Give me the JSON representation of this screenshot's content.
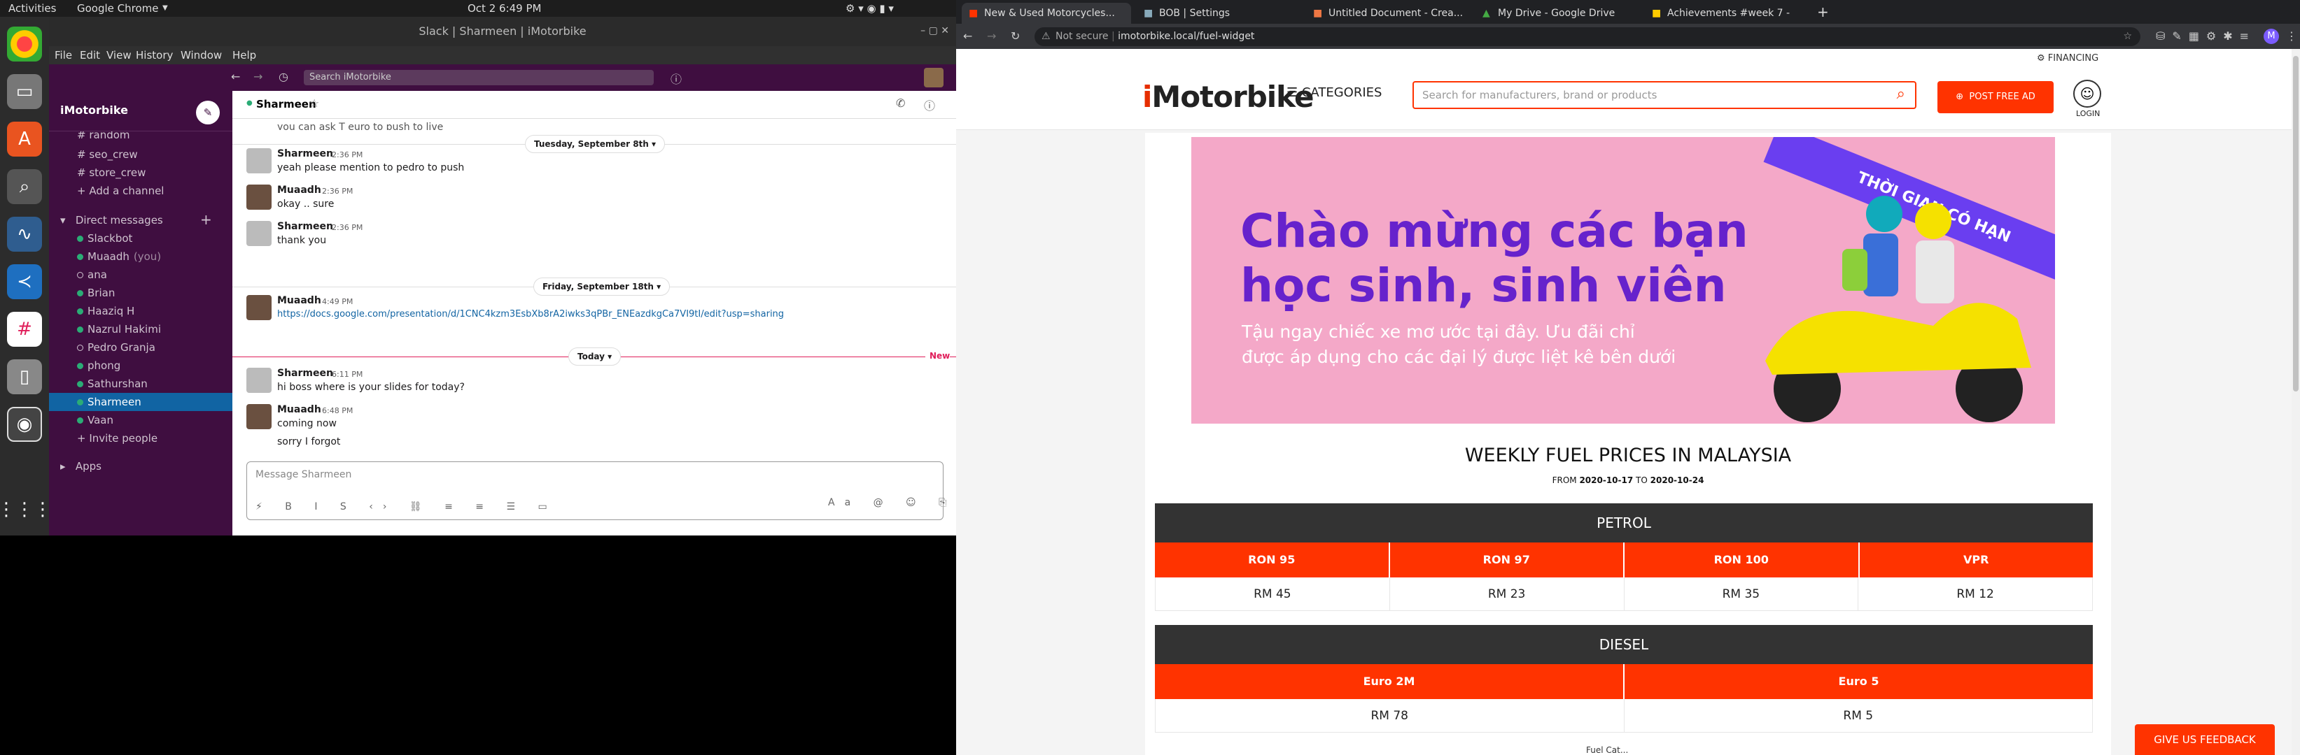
{
  "topbar": {
    "activities": "Activities",
    "app": "Google Chrome",
    "datetime": "Oct 2  6:49 PM"
  },
  "slack": {
    "window_title": "Slack | Sharmeen | iMotorbike",
    "menu": [
      "File",
      "Edit",
      "View",
      "History",
      "Window",
      "Help"
    ],
    "search_placeholder": "Search iMotorbike",
    "workspace": "iMotorbike",
    "channels": [
      "random",
      "seo_crew",
      "store_crew"
    ],
    "add_channel": "Add a channel",
    "dm_header": "Direct messages",
    "dms": [
      {
        "name": "Slackbot",
        "status": "online"
      },
      {
        "name": "Muaadh",
        "status": "online",
        "suffix": "(you)"
      },
      {
        "name": "ana",
        "status": "away"
      },
      {
        "name": "Brian",
        "status": "online"
      },
      {
        "name": "Haaziq H",
        "status": "online"
      },
      {
        "name": "Nazrul Hakimi",
        "status": "online"
      },
      {
        "name": "Pedro Granja",
        "status": "away"
      },
      {
        "name": "phong",
        "status": "online"
      },
      {
        "name": "Sathurshan",
        "status": "online"
      },
      {
        "name": "Sharmeen",
        "status": "online",
        "active": true
      },
      {
        "name": "Vaan",
        "status": "online"
      }
    ],
    "invite": "Invite people",
    "apps": "Apps",
    "channel_name": "Sharmeen",
    "partial_top": "you can ask T euro to push to live",
    "date1": "Tuesday, September 8th",
    "date2": "Friday, September 18th",
    "date3": "Today",
    "new_label": "New",
    "messages": [
      {
        "name": "Sharmeen",
        "time": "2:36 PM",
        "text": "yeah please mention to pedro to push"
      },
      {
        "name": "Muaadh",
        "time": "2:36 PM",
        "text": "okay .. sure"
      },
      {
        "name": "Sharmeen",
        "time": "2:36 PM",
        "text": "thank you"
      },
      {
        "name": "Muaadh",
        "time": "4:49 PM",
        "text": "https://docs.google.com/presentation/d/1CNC4kzm3EsbXb8rA2iwks3qPBr_ENEazdkgCa7VI9tI/edit?usp=sharing"
      },
      {
        "name": "Sharmeen",
        "time": "6:11 PM",
        "text": "hi boss where is your slides for today?"
      },
      {
        "name": "Muaadh",
        "time": "6:48 PM",
        "text": "coming now"
      },
      {
        "name": "",
        "time": "",
        "text": "sorry I forgot"
      }
    ],
    "composer_placeholder": "Message Sharmeen"
  },
  "chrome": {
    "tabs": [
      {
        "title": "New & Used Motorcycles..."
      },
      {
        "title": "BOB | Settings"
      },
      {
        "title": "Untitled Document - Crea..."
      },
      {
        "title": "My Drive - Google Drive"
      },
      {
        "title": "Achievements #week 7 -"
      }
    ],
    "not_secure": "Not secure",
    "url": "imotorbike.local/fuel-widget"
  },
  "site": {
    "financing": "FINANCING",
    "logo": "iMotorbike",
    "categories": "CATEGORIES",
    "search_placeholder": "Search for manufacturers, brand or products",
    "post_ad": "POST FREE AD",
    "login": "LOGIN",
    "banner": {
      "ribbon": "THỜI GIAN CÓ HẠN",
      "heading1": "Chào mừng các bạn",
      "heading2": "học sinh, sinh viên",
      "sub1": "Tậu ngay chiếc xe mơ ước tại đây. Ưu đãi chỉ",
      "sub2": "được áp dụng cho các đại lý được liệt kê bên dưới"
    },
    "fuel_title": "WEEKLY FUEL PRICES IN MALAYSIA",
    "from_label": "FROM",
    "from_date": "2020-10-17",
    "to_label": "TO",
    "to_date": "2020-10-24",
    "petrol_label": "PETROL",
    "petrol": [
      {
        "grade": "RON 95",
        "price": "RM 45"
      },
      {
        "grade": "RON 97",
        "price": "RM 23"
      },
      {
        "grade": "RON 100",
        "price": "RM 35"
      },
      {
        "grade": "VPR",
        "price": "RM 12"
      }
    ],
    "diesel_label": "DIESEL",
    "diesel": [
      {
        "grade": "Euro 2M",
        "price": "RM 78"
      },
      {
        "grade": "Euro 5",
        "price": "RM 5"
      }
    ],
    "feedback": "GIVE US FEEDBACK",
    "partial_bottom": "Fuel Cat..."
  },
  "colors": {
    "slack_purple": "#3f0e40",
    "accent_red": "#ff3300",
    "table_dark": "#333333"
  }
}
